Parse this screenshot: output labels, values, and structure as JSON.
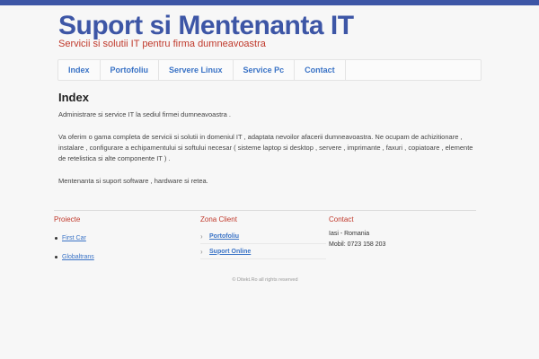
{
  "header": {
    "title": "Suport si Mentenanta IT",
    "tagline": "Servicii si solutii IT pentru firma dumneavoastra"
  },
  "nav": {
    "items": [
      {
        "label": "Index"
      },
      {
        "label": "Portofoliu"
      },
      {
        "label": "Servere Linux"
      },
      {
        "label": "Service Pc"
      },
      {
        "label": "Contact"
      }
    ]
  },
  "main": {
    "heading": "Index",
    "paragraphs": [
      "Administrare si service IT la sediul firmei dumneavoastra .",
      "Va oferim o gama completa de servicii si solutii in domeniul IT , adaptata nevoilor afacerii dumneavoastra. Ne ocupam de achizitionare , instalare , configurare a echipamentului si softului necesar ( sisteme laptop si desktop , servere , imprimante , faxuri , copiatoare , elemente de retelistica si alte componente IT ) .",
      "Mentenanta si suport software , hardware si retea."
    ]
  },
  "footer_cols": {
    "proiecte": {
      "title": "Proiecte",
      "items": [
        {
          "label": "First Car"
        },
        {
          "label": "Globaltrans"
        }
      ]
    },
    "zona": {
      "title": "Zona Client",
      "items": [
        {
          "label": "Portofoliu"
        },
        {
          "label": "Suport Online"
        }
      ]
    },
    "contact": {
      "title": "Contact",
      "lines": [
        "Iasi - Romania",
        "Mobil: 0723 158 203"
      ]
    }
  },
  "footer": {
    "copyright": "© Ditekt.Ro all rights reserved"
  },
  "colors": {
    "brand": "#3d56a6",
    "accent": "#c0392b",
    "link": "#3a73c6"
  }
}
